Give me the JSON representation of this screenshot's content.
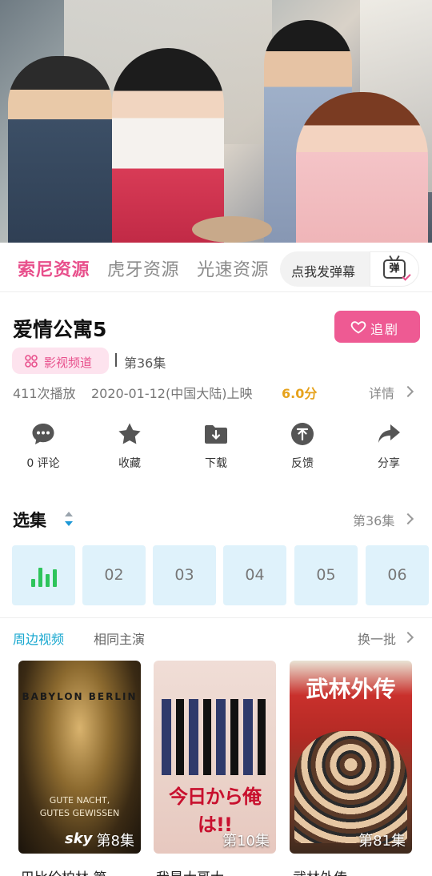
{
  "source_tabs": [
    {
      "label": "索尼资源",
      "active": true
    },
    {
      "label": "虎牙资源",
      "active": false
    },
    {
      "label": "光速资源",
      "active": false
    }
  ],
  "danmu": {
    "label": "点我发弹幕",
    "icon_text": "弹",
    "icon": "danmu-tv-icon"
  },
  "show": {
    "title": "爱情公寓5",
    "follow_label": "追剧",
    "channel_label": "影视频道",
    "current_episode": "第36集",
    "plays": "411次播放",
    "release": "2020-01-12(中国大陆)上映",
    "score": "6.0分",
    "details_label": "详情"
  },
  "actions": [
    {
      "label": "0 评论",
      "icon": "comment-icon"
    },
    {
      "label": "收藏",
      "icon": "star-icon"
    },
    {
      "label": "下载",
      "icon": "download-icon"
    },
    {
      "label": "反馈",
      "icon": "feedback-icon"
    },
    {
      "label": "分享",
      "icon": "share-icon"
    }
  ],
  "episodes": {
    "title": "选集",
    "current": "第36集",
    "items": [
      "playing",
      "02",
      "03",
      "04",
      "05",
      "06"
    ]
  },
  "related": {
    "tabs": [
      {
        "label": "周边视频",
        "active": true
      },
      {
        "label": "相同主演",
        "active": false
      }
    ],
    "refresh_label": "换一批",
    "posters": [
      {
        "badge": "第8集",
        "art_title": "BABYLON BERLIN",
        "art_line1": "GUTE NACHT,",
        "art_line2": "GUTES GEWISSEN",
        "brand": "sky",
        "caption": "巴比伦柏林 第"
      },
      {
        "badge": "第10集",
        "art_title": "今日から俺は!!",
        "caption": "我是大哥大"
      },
      {
        "badge": "第81集",
        "art_title": "武林外传",
        "caption": "武林外传"
      }
    ]
  },
  "colors": {
    "accent_pink": "#e8508c",
    "accent_blue": "#18a7cf",
    "score_orange": "#e6a21c",
    "episode_bg": "#dff2fb"
  }
}
